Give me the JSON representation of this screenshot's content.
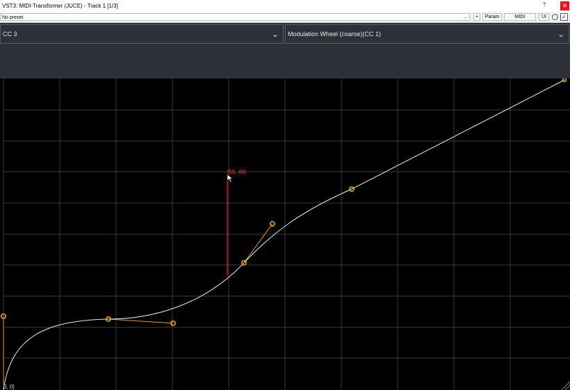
{
  "window": {
    "title": "VST3: MIDI-Transformer (JUCE) - Track 1 [1/3]",
    "pin_icon": "pin-icon",
    "close_icon": "close-icon"
  },
  "toolbar": {
    "preset": "No preset",
    "plus_label": "+",
    "param_label": "Param",
    "midi_label": "MIDI",
    "ui_label": "UI"
  },
  "header": {
    "source_cc": "CC 3",
    "target_cc": "Modulation Wheel (coarse)(CC 1)"
  },
  "graph": {
    "cursor_readout": "[59, 46]",
    "corner_readout": "0, 0]",
    "curve_color": "#ffffff",
    "handle_color": "#e6a020",
    "cursor_color": "#ff2020"
  }
}
